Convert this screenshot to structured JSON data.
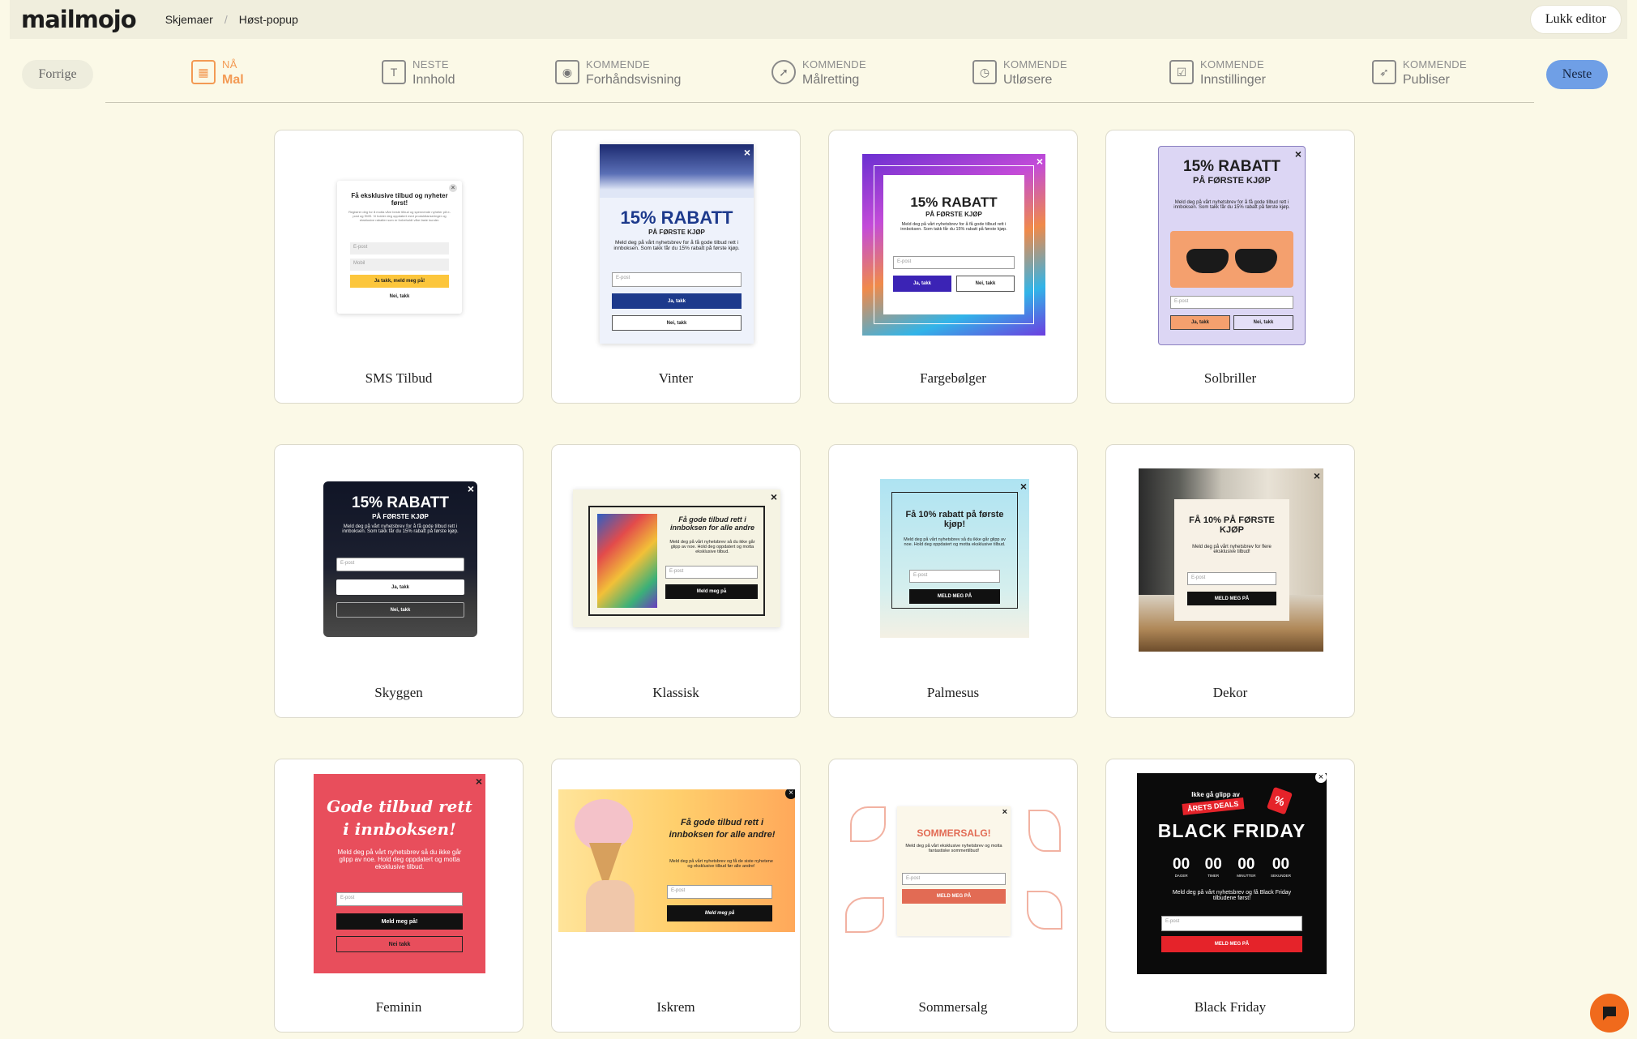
{
  "app": {
    "logo": "mailmojo"
  },
  "breadcrumb": {
    "root": "Skjemaer",
    "separator": "/",
    "current": "Høst-popup"
  },
  "header": {
    "close_label": "Lukk editor"
  },
  "nav": {
    "prev_label": "Forrige",
    "next_label": "Neste"
  },
  "steps": [
    {
      "status": "NÅ",
      "name": "Mal"
    },
    {
      "status": "NESTE",
      "name": "Innhold"
    },
    {
      "status": "KOMMENDE",
      "name": "Forhåndsvisning"
    },
    {
      "status": "KOMMENDE",
      "name": "Målretting"
    },
    {
      "status": "KOMMENDE",
      "name": "Utløsere"
    },
    {
      "status": "KOMMENDE",
      "name": "Innstillinger"
    },
    {
      "status": "KOMMENDE",
      "name": "Publiser"
    }
  ],
  "templates": [
    {
      "name": "SMS Tilbud",
      "preview": {
        "title": "Få eksklusive tilbud og nyheter først!",
        "body": "Registrer deg for å motta våre beste tilbud og spennende nyheter på e-post og SMS. Vi holder deg oppdatert med produktlanseringer og eksklusive rabatter som er forbeholdt våre faste kunder.",
        "email": "E-post",
        "mobile": "Mobil",
        "yes": "Ja takk, meld meg på!",
        "no": "Nei, takk"
      }
    },
    {
      "name": "Vinter",
      "preview": {
        "big": "15% RABATT",
        "sub": "PÅ FØRSTE KJØP",
        "body": "Meld deg på vårt nyhetsbrev for å få gode tilbud rett i innboksen. Som takk får du 15% rabatt på første kjøp.",
        "email": "E-post",
        "yes": "Ja, takk",
        "no": "Nei, takk"
      }
    },
    {
      "name": "Fargebølger",
      "preview": {
        "big": "15% RABATT",
        "sub": "PÅ FØRSTE KJØP",
        "body": "Meld deg på vårt nyhetsbrev for å få gode tilbud rett i innboksen. Som takk får du 15% rabatt på første kjøp.",
        "email": "E-post",
        "yes": "Ja, takk",
        "no": "Nei, takk"
      }
    },
    {
      "name": "Solbriller",
      "preview": {
        "big": "15% RABATT",
        "sub": "PÅ FØRSTE KJØP",
        "body": "Meld deg på vårt nyhetsbrev for å få gode tilbud rett i innboksen. Som takk får du 15% rabatt på første kjøp.",
        "email": "E-post",
        "yes": "Ja, takk",
        "no": "Nei, takk"
      }
    },
    {
      "name": "Skyggen",
      "preview": {
        "big": "15% RABATT",
        "sub": "PÅ FØRSTE KJØP",
        "body": "Meld deg på vårt nyhetsbrev for å få gode tilbud rett i innboksen. Som takk får du 15% rabatt på første kjøp.",
        "email": "E-post",
        "yes": "Ja, takk",
        "no": "Nei, takk"
      }
    },
    {
      "name": "Klassisk",
      "preview": {
        "title": "Få gode tilbud rett i innboksen for alle andre",
        "body": "Meld deg på vårt nyhetsbrev så du ikke går glipp av noe. Hold deg oppdatert og motta eksklusive tilbud.",
        "email": "E-post",
        "cta": "Meld meg på"
      }
    },
    {
      "name": "Palmesus",
      "preview": {
        "title": "Få 10% rabatt på første kjøp!",
        "body": "Meld deg på vårt nyhetsbrev så du ikke går glipp av noe. Hold deg oppdatert og motta eksklusive tilbud.",
        "email": "E-post",
        "cta": "MELD MEG PÅ"
      }
    },
    {
      "name": "Dekor",
      "preview": {
        "title": "FÅ 10% PÅ FØRSTE KJØP",
        "body": "Meld deg på vårt nyhetsbrev for flere eksklusive tilbud!",
        "email": "E-post",
        "cta": "MELD MEG PÅ"
      }
    },
    {
      "name": "Feminin",
      "preview": {
        "title": "Gode tilbud rett i innboksen!",
        "body": "Meld deg på vårt nyhetsbrev så du ikke går glipp av noe. Hold deg oppdatert og motta eksklusive tilbud.",
        "email": "E-post",
        "yes": "Meld meg på!",
        "no": "Nei takk"
      }
    },
    {
      "name": "Iskrem",
      "preview": {
        "title": "Få gode tilbud rett i innboksen for alle andre!",
        "body": "Meld deg på vårt nyhetsbrev og få de siste nyhetene og eksklusive tilbud før alle andre!",
        "email": "E-post",
        "cta": "Meld meg på"
      }
    },
    {
      "name": "Sommersalg",
      "preview": {
        "title": "SOMMERSALG!",
        "body": "Meld deg på vårt eksklusive nyhetsbrev og motta fantastiske sommertilbud!",
        "email": "E-post",
        "cta": "MELD MEG PÅ"
      }
    },
    {
      "name": "Black Friday",
      "preview": {
        "kicker": "Ikke gå glipp av",
        "tag": "ÅRETS DEALS",
        "title": "BLACK FRIDAY",
        "count": [
          "00",
          "00",
          "00",
          "00"
        ],
        "units": [
          "DAGER",
          "TIMER",
          "MINUTTER",
          "SEKUNDER"
        ],
        "body": "Meld deg på vårt nyhetsbrev og få Black Friday tilbudene først!",
        "email": "E-post",
        "cta": "MELD MEG PÅ"
      }
    }
  ],
  "colors": {
    "background": "#fbf9e7",
    "accent_active_step": "#f39a54",
    "next_button": "#6f9fe6",
    "chat_button": "#f06a1c"
  }
}
